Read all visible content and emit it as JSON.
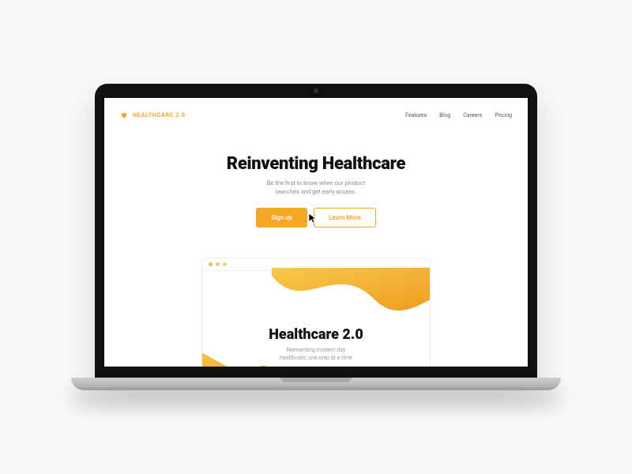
{
  "brand": {
    "name": "HEALTHCARE 2.0"
  },
  "nav": {
    "items": [
      "Features",
      "Blog",
      "Careers",
      "Pricing"
    ]
  },
  "hero": {
    "title": "Reinventing Healthcare",
    "subtitle_line1": "Be the first to know when our product",
    "subtitle_line2": "launches and get early access.",
    "primary_cta": "Sign up",
    "secondary_cta": "Learn More"
  },
  "preview": {
    "title": "Healthcare 2.0",
    "subtitle_line1": "Reinventing modern day",
    "subtitle_line2": "healthcare, one step at a time"
  },
  "colors": {
    "accent": "#f5a623"
  }
}
